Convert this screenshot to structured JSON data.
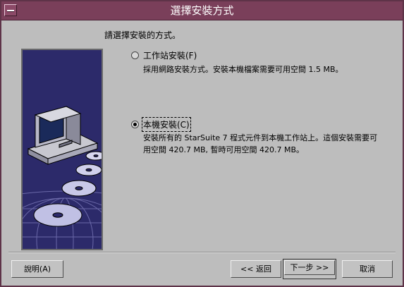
{
  "window": {
    "title": "選擇安裝方式"
  },
  "page": {
    "prompt": "請選擇安裝的方式。"
  },
  "options": [
    {
      "label": "工作站安裝(F)",
      "description": [
        "採用網路安裝方式。安裝本機檔案需要可用空間 1.5 MB。"
      ],
      "selected": false
    },
    {
      "label": "本機安裝(C)",
      "description": [
        "安裝所有的 StarSuite 7 程式元件到本機工作站上。這個安裝需要可",
        "用空間 420.7 MB, 暫時可用空間 420.7 MB。"
      ],
      "selected": true
    }
  ],
  "buttons": {
    "help": "說明(A)",
    "back": "<< 返回",
    "next": "下一步 >>",
    "cancel": "取消"
  },
  "colors": {
    "titlebar": "#7a3f5a",
    "art_background": "#2c2a6a",
    "dialog_background": "#bdbdbd"
  }
}
